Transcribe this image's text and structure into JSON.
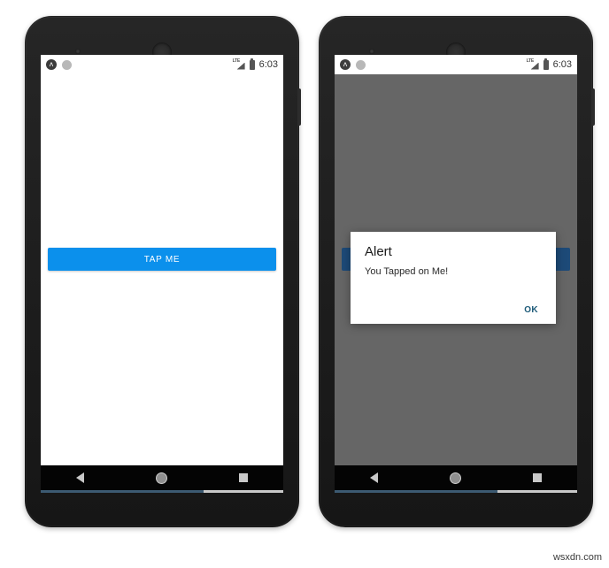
{
  "watermark": "wsxdn.com",
  "status_bar": {
    "app_badge_glyph": "ʌ",
    "app_badge_name": "app-notification-icon",
    "second_icon_name": "circle-notification-icon",
    "network_label": "LTE",
    "battery_name": "battery-icon",
    "time": "6:03"
  },
  "phones": [
    {
      "id": "phone-left",
      "state": "default",
      "screen": {
        "button_label": "TAP ME",
        "dialog_visible": false
      }
    },
    {
      "id": "phone-right",
      "state": "dialog-open",
      "screen": {
        "button_label": "TAP ME",
        "dialog_visible": true,
        "dialog": {
          "title": "Alert",
          "message": "You Tapped on Me!",
          "ok_label": "OK"
        }
      }
    }
  ],
  "nav_bar": {
    "back_name": "nav-back-icon",
    "home_name": "nav-home-icon",
    "recent_name": "nav-recent-apps-icon"
  },
  "colors": {
    "button_blue": "#0b90ec",
    "button_blue_dimmed": "#1d4a78",
    "scrim_gray": "#666666",
    "ok_text": "#1c5a78",
    "scroll_thumb": "#3c5a72"
  }
}
